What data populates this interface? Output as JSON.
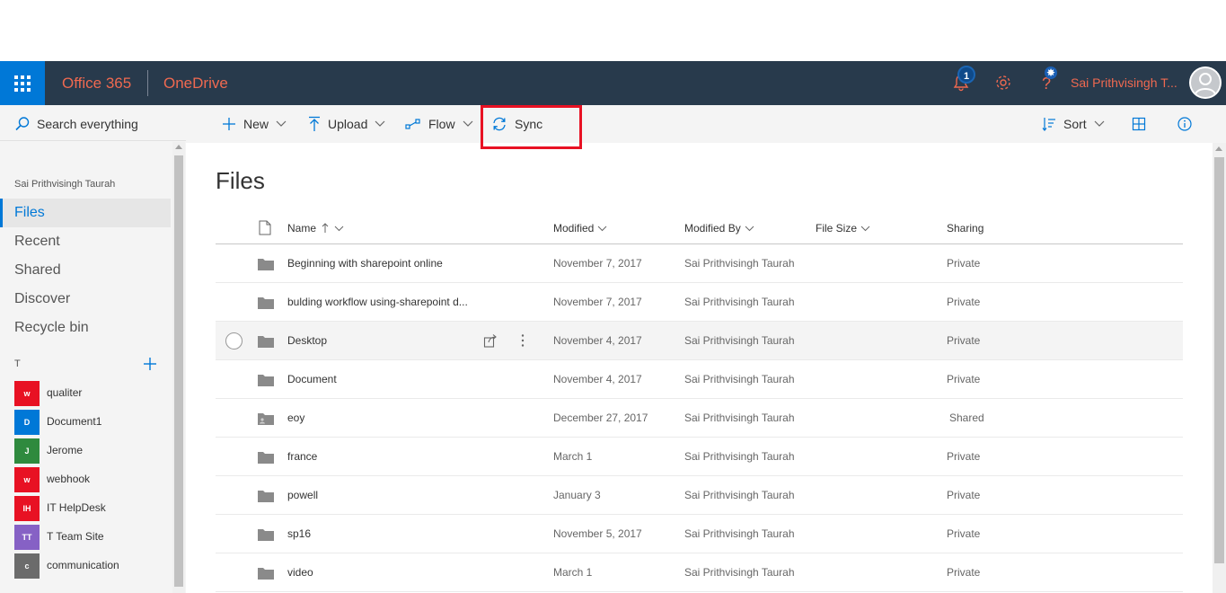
{
  "suite_bar": {
    "brand": "Office 365",
    "app": "OneDrive",
    "notification_count": "1",
    "user_name": "Sai Prithvisingh T...",
    "icons": [
      "waffle-icon",
      "bell-icon",
      "gear-icon",
      "help-icon",
      "avatar-icon"
    ],
    "colors": {
      "bar": "#283a4c",
      "waffle": "#0078d7",
      "accent_text": "#ef6950"
    }
  },
  "search": {
    "placeholder": "Search everything"
  },
  "nav": {
    "owner": "Sai Prithvisingh Taurah",
    "items": [
      {
        "label": "Files",
        "active": true
      },
      {
        "label": "Recent"
      },
      {
        "label": "Shared"
      },
      {
        "label": "Discover"
      },
      {
        "label": "Recycle bin"
      }
    ],
    "groups_heading": "T",
    "groups": [
      {
        "initials": "w",
        "label": "qualiter",
        "color": "#e81123"
      },
      {
        "initials": "D",
        "label": "Document1",
        "color": "#0078d7"
      },
      {
        "initials": "J",
        "label": "Jerome",
        "color": "#2f8a3e"
      },
      {
        "initials": "w",
        "label": "webhook",
        "color": "#e81123"
      },
      {
        "initials": "IH",
        "label": "IT HelpDesk",
        "color": "#e81123"
      },
      {
        "initials": "TT",
        "label": "T       Team Site",
        "color": "#8661c5"
      },
      {
        "initials": "c",
        "label": "communication",
        "color": "#6b6b6b"
      }
    ]
  },
  "toolbar": {
    "new": "New",
    "upload": "Upload",
    "flow": "Flow",
    "sync": "Sync",
    "sort": "Sort"
  },
  "main": {
    "title": "Files",
    "columns": {
      "name": "Name",
      "modified": "Modified",
      "modified_by": "Modified By",
      "file_size": "File Size",
      "sharing": "Sharing"
    },
    "rows": [
      {
        "name": "Beginning with sharepoint online",
        "modified": "November 7, 2017",
        "modified_by": "Sai Prithvisingh Taurah",
        "sharing": "Private"
      },
      {
        "name": "bulding workflow using-sharepoint d...",
        "modified": "November 7, 2017",
        "modified_by": "Sai Prithvisingh Taurah",
        "sharing": "Private"
      },
      {
        "name": "Desktop",
        "modified": "November 4, 2017",
        "modified_by": "Sai Prithvisingh Taurah",
        "sharing": "Private"
      },
      {
        "name": "Document",
        "modified": "November 4, 2017",
        "modified_by": "Sai Prithvisingh Taurah",
        "sharing": "Private"
      },
      {
        "name": "eoy",
        "modified": "December 27, 2017",
        "modified_by": "Sai Prithvisingh Taurah",
        "sharing": "Shared"
      },
      {
        "name": "france",
        "modified": "March 1",
        "modified_by": "Sai Prithvisingh Taurah",
        "sharing": "Private"
      },
      {
        "name": "powell",
        "modified": "January 3",
        "modified_by": "Sai Prithvisingh Taurah",
        "sharing": "Private"
      },
      {
        "name": "sp16",
        "modified": "November 5, 2017",
        "modified_by": "Sai Prithvisingh Taurah",
        "sharing": "Private"
      },
      {
        "name": "video",
        "modified": "March 1",
        "modified_by": "Sai Prithvisingh Taurah",
        "sharing": "Private"
      }
    ]
  }
}
